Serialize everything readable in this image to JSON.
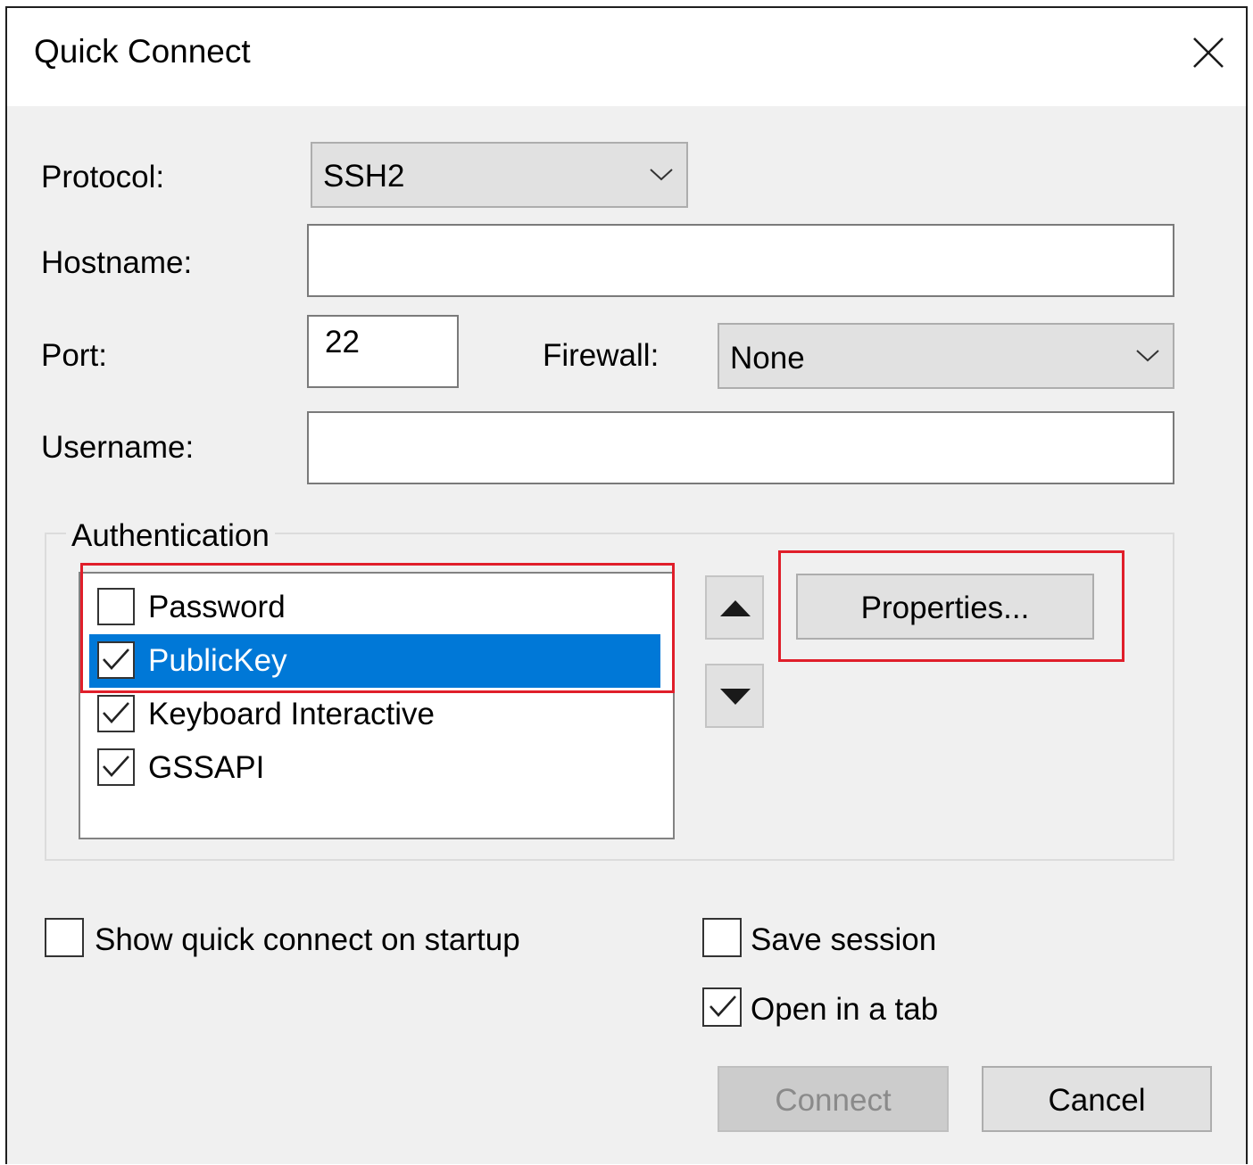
{
  "window": {
    "title": "Quick Connect"
  },
  "form": {
    "protocol_label": "Protocol:",
    "protocol_value": "SSH2",
    "hostname_label": "Hostname:",
    "hostname_value": "",
    "port_label": "Port:",
    "port_value": "22",
    "firewall_label": "Firewall:",
    "firewall_value": "None",
    "username_label": "Username:",
    "username_value": ""
  },
  "authentication": {
    "legend": "Authentication",
    "items": [
      {
        "label": "Password",
        "checked": false,
        "selected": false
      },
      {
        "label": "PublicKey",
        "checked": true,
        "selected": true
      },
      {
        "label": "Keyboard Interactive",
        "checked": true,
        "selected": false
      },
      {
        "label": "GSSAPI",
        "checked": true,
        "selected": false
      }
    ],
    "properties_label": "Properties..."
  },
  "options": {
    "show_on_startup_label": "Show quick connect on startup",
    "show_on_startup_checked": false,
    "save_session_label": "Save session",
    "save_session_checked": false,
    "open_in_tab_label": "Open in a tab",
    "open_in_tab_checked": true
  },
  "buttons": {
    "connect_label": "Connect",
    "connect_enabled": false,
    "cancel_label": "Cancel"
  },
  "colors": {
    "selection": "#0078d7",
    "highlight_box": "#e01e2a",
    "dialog_bg": "#f0f0f0"
  }
}
